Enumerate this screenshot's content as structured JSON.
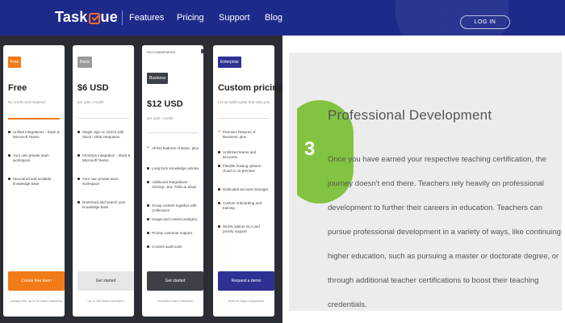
{
  "header": {
    "logo_text_a": "Task",
    "logo_text_b": "ue",
    "nav": [
      "Features",
      "Pricing",
      "Support",
      "Blog"
    ],
    "login": "LOG IN",
    "colors": {
      "bg": "#1e2a8a",
      "accent": "#ff6b2c"
    }
  },
  "plans": [
    {
      "badge": "Free",
      "badge_color": "#f07b17",
      "price": "Free",
      "subtitle": "No credit card required",
      "features": [
        "Unified integrations - Slack & Microsoft Teams",
        "Your own private team workspace",
        "Structured and scalable knowledge base"
      ],
      "cta": "Create free team",
      "cta_color": "#f07b17",
      "footnote": "Always free up to 50 team members"
    },
    {
      "badge": "Basic",
      "badge_color": "#9a9a9a",
      "price": "$6 USD",
      "subtitle": "per user / month",
      "features": [
        "Single sign-on (SSO) with Slack / Okta integration",
        "ClickOps integration - Slack & Microsoft Teams",
        "Your own private team workspace",
        "Download and search your knowledge base"
      ],
      "cta": "Get started",
      "cta_color": "#e4e6e8",
      "footnote": "Up to 250 team members"
    },
    {
      "recommended": "RECOMMENDED",
      "badge": "Business",
      "badge_color": "#3d4147",
      "price": "$12 USD",
      "subtitle": "per user / month",
      "features": [
        "All the features of Basic, plus",
        "Long form knowledge articles",
        "Additional integrations - ClickUp, Jira, Trello & Slack",
        "Group content together with Collections",
        "Usage and content analytics",
        "Priority customer support",
        "Content audit tools"
      ],
      "cta": "Get started",
      "cta_color": "#3d4147",
      "footnote": "Unlimited team members"
    },
    {
      "badge": "Enterprise",
      "badge_color": "#2e3192",
      "price": "Custom pricing",
      "subtitle": "Let us build a plan that suits you",
      "features": [
        "Premium features of Business, plus",
        "Unlimited teams and accounts",
        "Flexible hosting options - cloud or on-premise",
        "Dedicated account manager",
        "Custom onboarding and training",
        "99.9% uptime SLA and priority support"
      ],
      "cta": "Request a demo",
      "cta_color": "#2e3192",
      "footnote": "Built for large companies"
    }
  ],
  "step": {
    "number": "3",
    "title": "Professional Development",
    "body": "Once you have earned your respective teaching certification, the journey doesn't end there. Teachers rely heavily on professional development to further their careers in education. Teachers can pursue professional development in a variety of ways, like continuing higher education, such as pursuing a master or doctorate degree, or through additional teacher certifications to boost their teaching credentials.",
    "accent_color": "#82c341"
  }
}
